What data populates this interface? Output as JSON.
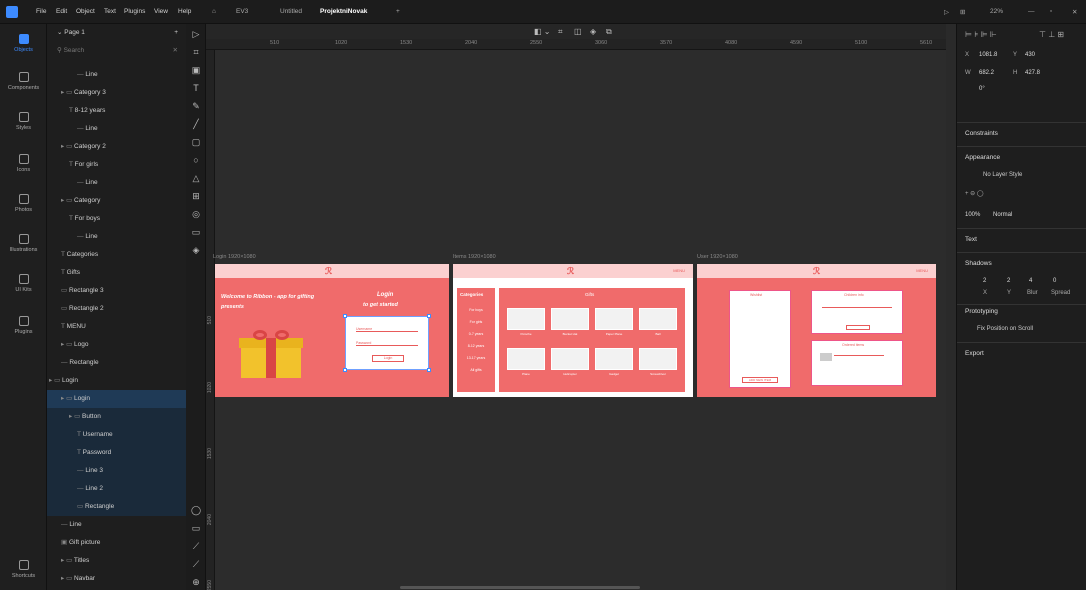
{
  "menubar": {
    "items": [
      "File",
      "Edit",
      "Object",
      "Text",
      "Plugins",
      "View",
      "Help"
    ],
    "tabs": [
      "EV3",
      "Untitled",
      "ProjektniNovak"
    ],
    "zoom": "22%"
  },
  "rail": [
    "Objects",
    "Components",
    "Styles",
    "Icons",
    "Photos",
    "Illustrations",
    "UI Kits",
    "Plugins",
    "Shortcuts"
  ],
  "layers": {
    "page": "Page 1",
    "search_placeholder": "Search",
    "rows": [
      "Line",
      "Category 3",
      "8-12 years",
      "Line",
      "Category 2",
      "For girls",
      "Line",
      "Category",
      "For boys",
      "Line",
      "Categories",
      "Gifts",
      "Rectangle 3",
      "Rectangle 2",
      "MENU",
      "Logo",
      "Rectangle",
      "Login",
      "Login",
      "Button",
      "Username",
      "Password",
      "Line 3",
      "Line 2",
      "Rectangle",
      "Line",
      "Gift picture",
      "Titles",
      "Navbar"
    ]
  },
  "ruler": {
    "h": [
      "510",
      "1020",
      "1530",
      "2040",
      "2550",
      "3060",
      "3570",
      "4080",
      "4590",
      "5100",
      "5610"
    ],
    "v": [
      "510",
      "1020",
      "1530",
      "2040",
      "2550"
    ]
  },
  "artboards": {
    "login": {
      "label": "Login 1920×1080",
      "welcome": "Welcome to Ribbon - app for gifting presents",
      "login_title": "Login",
      "login_sub": "to get started",
      "username": "Username",
      "password": "Password",
      "button": "Login"
    },
    "items": {
      "label": "Items 1920×1080",
      "menu": "MENU",
      "categories": "Categories",
      "gifts": "Gifts",
      "cats": [
        "For boys",
        "For girls",
        "0-7 years",
        "8-12 years",
        "13-17 years",
        "All gifts"
      ],
      "gift_names": [
        "Porsche",
        "Bucket Hat",
        "Paper Plane",
        "Ball",
        "Plane",
        "Helicopter",
        "Gadget",
        "Screwdriver"
      ]
    },
    "user": {
      "label": "User 1920×1080",
      "menu": "MENU",
      "wishlist": "Wishlist",
      "children_info": "Children info",
      "ordered": "Ordered items",
      "add_btn": "ADD NEW ITEM"
    }
  },
  "rpanel": {
    "x": "1081.8",
    "y": "430",
    "w": "682.2",
    "h": "427.8",
    "angle": "0°",
    "constraints": "Constraints",
    "appearance": "Appearance",
    "no_layer_style": "No Layer Style",
    "opacity": "100%",
    "blend": "Normal",
    "text": "Text",
    "shadows": "Shadows",
    "sh_vals": [
      "2",
      "2",
      "4",
      "0"
    ],
    "sh_labels": [
      "X",
      "Y",
      "Blur",
      "Spread"
    ],
    "prototyping": "Prototyping",
    "fix_pos": "Fix Position on Scroll",
    "export": "Export"
  }
}
